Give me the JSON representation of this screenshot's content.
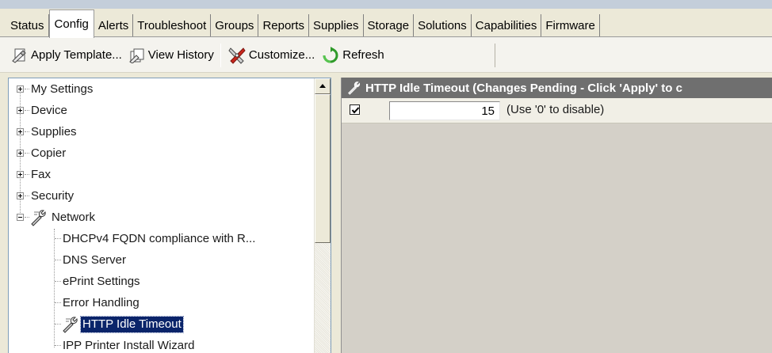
{
  "tabs": [
    {
      "label": "Status"
    },
    {
      "label": "Config"
    },
    {
      "label": "Alerts"
    },
    {
      "label": "Troubleshoot"
    },
    {
      "label": "Groups"
    },
    {
      "label": "Reports"
    },
    {
      "label": "Supplies"
    },
    {
      "label": "Storage"
    },
    {
      "label": "Solutions"
    },
    {
      "label": "Capabilities"
    },
    {
      "label": "Firmware"
    }
  ],
  "active_tab": "Config",
  "toolbar": {
    "apply_template": "Apply Template...",
    "view_history": "View History",
    "customize": "Customize...",
    "refresh": "Refresh"
  },
  "tree": {
    "roots": [
      {
        "label": "My Settings",
        "state": "collapsed"
      },
      {
        "label": "Device",
        "state": "collapsed"
      },
      {
        "label": "Supplies",
        "state": "collapsed"
      },
      {
        "label": "Copier",
        "state": "collapsed"
      },
      {
        "label": "Fax",
        "state": "collapsed"
      },
      {
        "label": "Security",
        "state": "collapsed"
      },
      {
        "label": "Network",
        "state": "expanded",
        "icon": "wrench-icon"
      }
    ],
    "network_children": [
      {
        "label": "DHCPv4 FQDN compliance with R..."
      },
      {
        "label": "DNS Server"
      },
      {
        "label": "ePrint Settings"
      },
      {
        "label": "Error Handling"
      },
      {
        "label": "HTTP Idle Timeout",
        "selected": true,
        "icon": "wrench-icon"
      },
      {
        "label": "IPP Printer Install Wizard"
      }
    ]
  },
  "detail": {
    "header": "HTTP Idle Timeout (Changes Pending - Click 'Apply' to c",
    "checkbox_checked": true,
    "timeout_value": "15",
    "hint": "(Use '0' to disable)"
  },
  "colors": {
    "selection_bg": "#0a246a",
    "header_bg": "#6f6f6f",
    "frame_bg": "#ece9d8"
  }
}
